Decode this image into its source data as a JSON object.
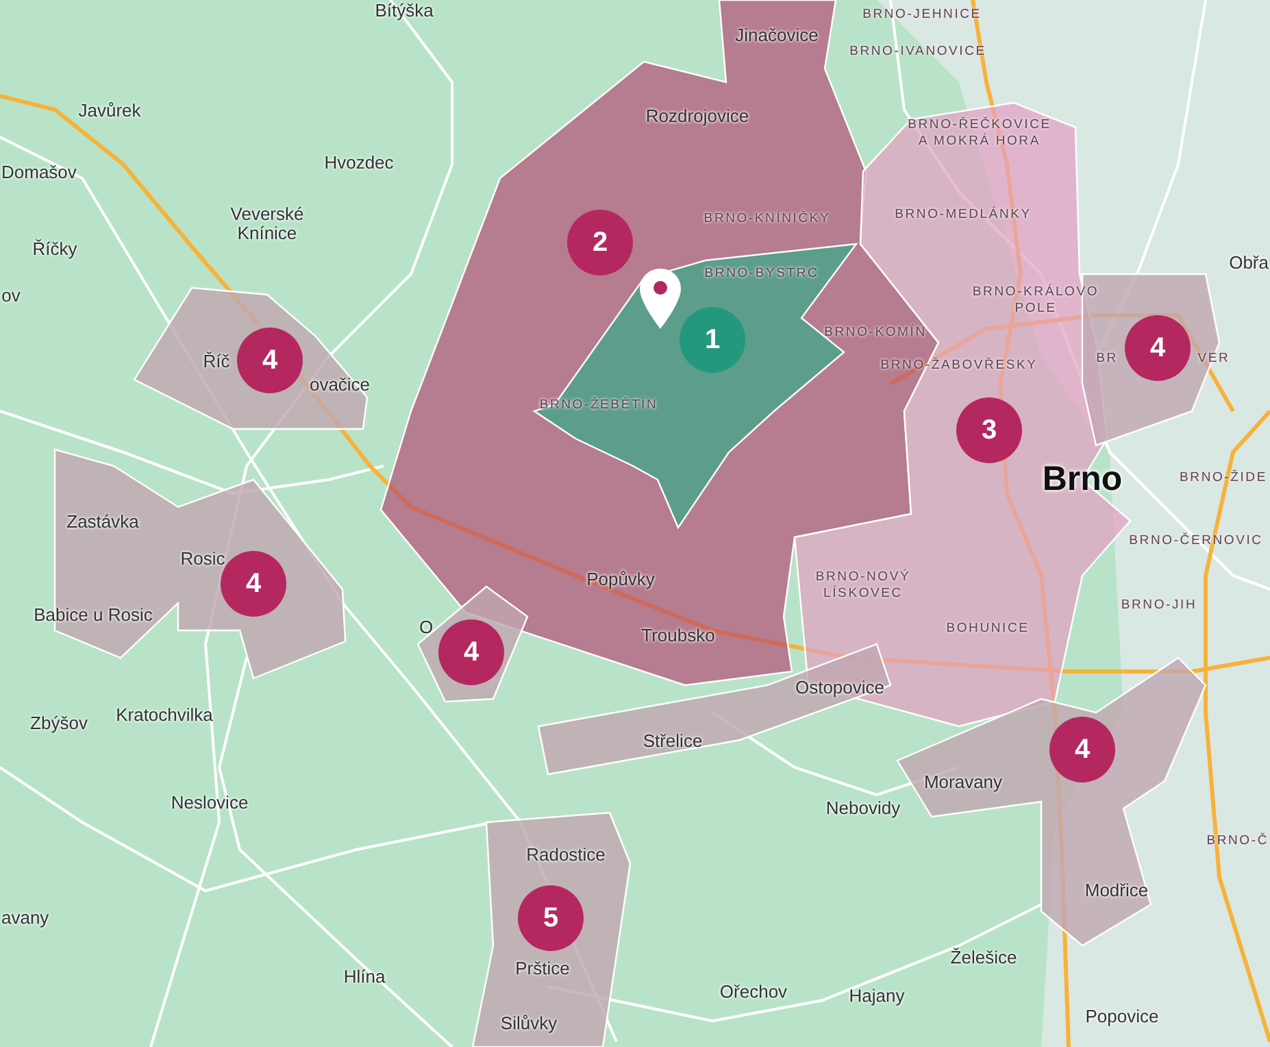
{
  "map": {
    "places": [
      {
        "text": "Bítýška",
        "kind": "town"
      },
      {
        "text": "Javůrek",
        "kind": "town"
      },
      {
        "text": "Domašov",
        "kind": "town"
      },
      {
        "text": "Hvozdec",
        "kind": "town"
      },
      {
        "text": "Veverské\nKnínice",
        "kind": "town"
      },
      {
        "text": "Říčky",
        "kind": "town"
      },
      {
        "text": "ov",
        "kind": "town"
      },
      {
        "text": "Říč",
        "kind": "town"
      },
      {
        "text": "ovačice",
        "kind": "town"
      },
      {
        "text": "Zastávka",
        "kind": "town"
      },
      {
        "text": "Rosic",
        "kind": "town"
      },
      {
        "text": "Babice u Rosic",
        "kind": "town"
      },
      {
        "text": "O",
        "kind": "town"
      },
      {
        "text": "Zbýšov",
        "kind": "town"
      },
      {
        "text": "Kratochvilka",
        "kind": "town"
      },
      {
        "text": "Neslovice",
        "kind": "town"
      },
      {
        "text": "avany",
        "kind": "town"
      },
      {
        "text": "Radostice",
        "kind": "town"
      },
      {
        "text": "Hlína",
        "kind": "town"
      },
      {
        "text": "Prštice",
        "kind": "town"
      },
      {
        "text": "Silůvky",
        "kind": "town"
      },
      {
        "text": "Jinačovice",
        "kind": "town"
      },
      {
        "text": "Rozdrojovice",
        "kind": "town"
      },
      {
        "text": "Popůvky",
        "kind": "town"
      },
      {
        "text": "Troubsko",
        "kind": "town"
      },
      {
        "text": "Ostopovice",
        "kind": "town"
      },
      {
        "text": "Střelice",
        "kind": "town"
      },
      {
        "text": "Nebovidy",
        "kind": "town"
      },
      {
        "text": "Moravany",
        "kind": "town"
      },
      {
        "text": "Ořechov",
        "kind": "town"
      },
      {
        "text": "Hajany",
        "kind": "town"
      },
      {
        "text": "Želešice",
        "kind": "town"
      },
      {
        "text": "Modřice",
        "kind": "town"
      },
      {
        "text": "Popovice",
        "kind": "town"
      },
      {
        "text": "Obřa",
        "kind": "town"
      },
      {
        "text": "Brno",
        "kind": "city"
      },
      {
        "text": "BRNO-JEHNICE",
        "kind": "district"
      },
      {
        "text": "BRNO-IVANOVICE",
        "kind": "district"
      },
      {
        "text": "BRNO-ŘEČKOVICE\nA MOKRÁ HORA",
        "kind": "district"
      },
      {
        "text": "BRNO-KNÍNIČKY",
        "kind": "district"
      },
      {
        "text": "BRNO-MEDLÁNKY",
        "kind": "district"
      },
      {
        "text": "BRNO-BYSTRC",
        "kind": "district"
      },
      {
        "text": "BRNO-KRÁLOVO\nPOLE",
        "kind": "district"
      },
      {
        "text": "BRNO-KOMÍN",
        "kind": "district"
      },
      {
        "text": "BRNO-ŽABOVŘESKY",
        "kind": "district"
      },
      {
        "text": "BRNO-ŽEBĚTÍN",
        "kind": "district"
      },
      {
        "text": "BR",
        "kind": "district"
      },
      {
        "text": "VER",
        "kind": "district"
      },
      {
        "text": "BRNO-ŽIDE",
        "kind": "district"
      },
      {
        "text": "BRNO-ČERNOVIC",
        "kind": "district"
      },
      {
        "text": "BRNO-NOVÝ\nLÍSKOVEC",
        "kind": "district"
      },
      {
        "text": "BOHUNICE",
        "kind": "district"
      },
      {
        "text": "BRNO-JIH",
        "kind": "district"
      },
      {
        "text": "BRNO-Č",
        "kind": "district"
      }
    ],
    "markers": [
      {
        "label": "1",
        "color": "#23987c"
      },
      {
        "label": "2",
        "color": "#b5285f"
      },
      {
        "label": "4",
        "color": "#b5285f"
      },
      {
        "label": "3",
        "color": "#b5285f"
      },
      {
        "label": "4",
        "color": "#b5285f"
      },
      {
        "label": "4",
        "color": "#b5285f"
      },
      {
        "label": "4",
        "color": "#b5285f"
      },
      {
        "label": "4",
        "color": "#b5285f"
      },
      {
        "label": "5",
        "color": "#b5285f"
      }
    ]
  }
}
